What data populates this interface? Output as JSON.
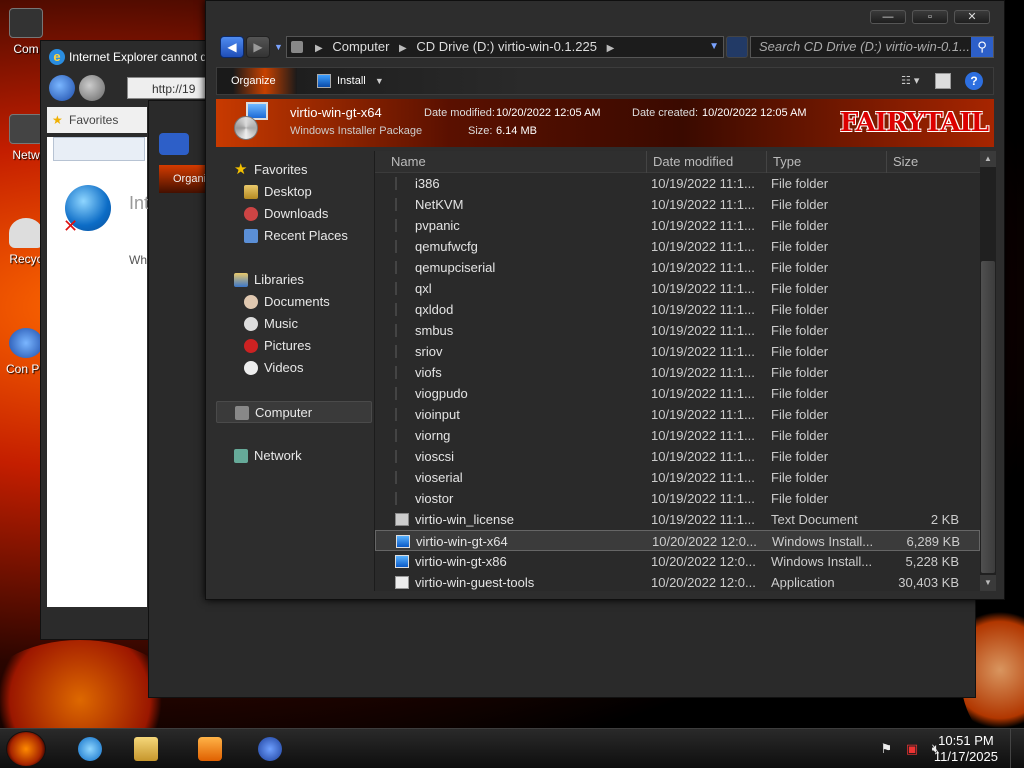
{
  "desktop": {
    "icons": [
      "Com",
      "Netw",
      "Recyc",
      "Con Pa"
    ]
  },
  "ie_window": {
    "title": "Internet Explorer cannot d",
    "address": "http://19",
    "favorites_label": "Favorites",
    "heading": "Int",
    "body_text": "Wh"
  },
  "bg_explorer": {
    "organize_label": "Organi"
  },
  "explorer": {
    "breadcrumb": [
      "Computer",
      "CD Drive (D:) virtio-win-0.1.225"
    ],
    "search_placeholder": "Search CD Drive (D:) virtio-win-0.1...",
    "toolbar": {
      "organize_label": "Organize",
      "install_label": "Install"
    },
    "details": {
      "file_name": "virtio-win-gt-x64",
      "file_type": "Windows Installer Package",
      "date_modified_label": "Date modified:",
      "date_modified_value": "10/20/2022 12:05 AM",
      "date_created_label": "Date created:",
      "date_created_value": "10/20/2022 12:05 AM",
      "size_label": "Size:",
      "size_value": "6.14 MB",
      "logo_text": "FAIRYTAIL"
    },
    "nav": {
      "favorites": "Favorites",
      "desktop": "Desktop",
      "downloads": "Downloads",
      "recent_places": "Recent Places",
      "libraries": "Libraries",
      "documents": "Documents",
      "music": "Music",
      "pictures": "Pictures",
      "videos": "Videos",
      "computer": "Computer",
      "network": "Network"
    },
    "columns": {
      "name": "Name",
      "date_modified": "Date modified",
      "type": "Type",
      "size": "Size"
    },
    "files": [
      {
        "name": "i386",
        "date": "10/19/2022 11:1...",
        "type": "File folder",
        "size": "",
        "icon": "folder-icon"
      },
      {
        "name": "NetKVM",
        "date": "10/19/2022 11:1...",
        "type": "File folder",
        "size": "",
        "icon": "folder-icon"
      },
      {
        "name": "pvpanic",
        "date": "10/19/2022 11:1...",
        "type": "File folder",
        "size": "",
        "icon": "folder-icon"
      },
      {
        "name": "qemufwcfg",
        "date": "10/19/2022 11:1...",
        "type": "File folder",
        "size": "",
        "icon": "folder-icon"
      },
      {
        "name": "qemupciserial",
        "date": "10/19/2022 11:1...",
        "type": "File folder",
        "size": "",
        "icon": "folder-icon"
      },
      {
        "name": "qxl",
        "date": "10/19/2022 11:1...",
        "type": "File folder",
        "size": "",
        "icon": "folder-icon"
      },
      {
        "name": "qxldod",
        "date": "10/19/2022 11:1...",
        "type": "File folder",
        "size": "",
        "icon": "folder-icon"
      },
      {
        "name": "smbus",
        "date": "10/19/2022 11:1...",
        "type": "File folder",
        "size": "",
        "icon": "folder-icon"
      },
      {
        "name": "sriov",
        "date": "10/19/2022 11:1...",
        "type": "File folder",
        "size": "",
        "icon": "folder-icon"
      },
      {
        "name": "viofs",
        "date": "10/19/2022 11:1...",
        "type": "File folder",
        "size": "",
        "icon": "folder-icon"
      },
      {
        "name": "viogpudo",
        "date": "10/19/2022 11:1...",
        "type": "File folder",
        "size": "",
        "icon": "folder-icon"
      },
      {
        "name": "vioinput",
        "date": "10/19/2022 11:1...",
        "type": "File folder",
        "size": "",
        "icon": "folder-icon"
      },
      {
        "name": "viorng",
        "date": "10/19/2022 11:1...",
        "type": "File folder",
        "size": "",
        "icon": "folder-icon"
      },
      {
        "name": "vioscsi",
        "date": "10/19/2022 11:1...",
        "type": "File folder",
        "size": "",
        "icon": "folder-icon"
      },
      {
        "name": "vioserial",
        "date": "10/19/2022 11:1...",
        "type": "File folder",
        "size": "",
        "icon": "folder-icon"
      },
      {
        "name": "viostor",
        "date": "10/19/2022 11:1...",
        "type": "File folder",
        "size": "",
        "icon": "folder-icon"
      },
      {
        "name": "virtio-win_license",
        "date": "10/19/2022 11:1...",
        "type": "Text Document",
        "size": "2 KB",
        "icon": "text-document-icon"
      },
      {
        "name": "virtio-win-gt-x64",
        "date": "10/20/2022 12:0...",
        "type": "Windows Install...",
        "size": "6,289 KB",
        "icon": "installer-icon",
        "selected": true
      },
      {
        "name": "virtio-win-gt-x86",
        "date": "10/20/2022 12:0...",
        "type": "Windows Install...",
        "size": "5,228 KB",
        "icon": "installer-icon"
      },
      {
        "name": "virtio-win-guest-tools",
        "date": "10/20/2022 12:0...",
        "type": "Application",
        "size": "30,403 KB",
        "icon": "application-icon"
      }
    ]
  },
  "taskbar": {
    "time": "10:51 PM",
    "date": "11/17/2025"
  },
  "colors": {
    "accent": "#c83a00",
    "window_bg": "#2d2d2d",
    "nav_blue": "#2d5fc8"
  }
}
